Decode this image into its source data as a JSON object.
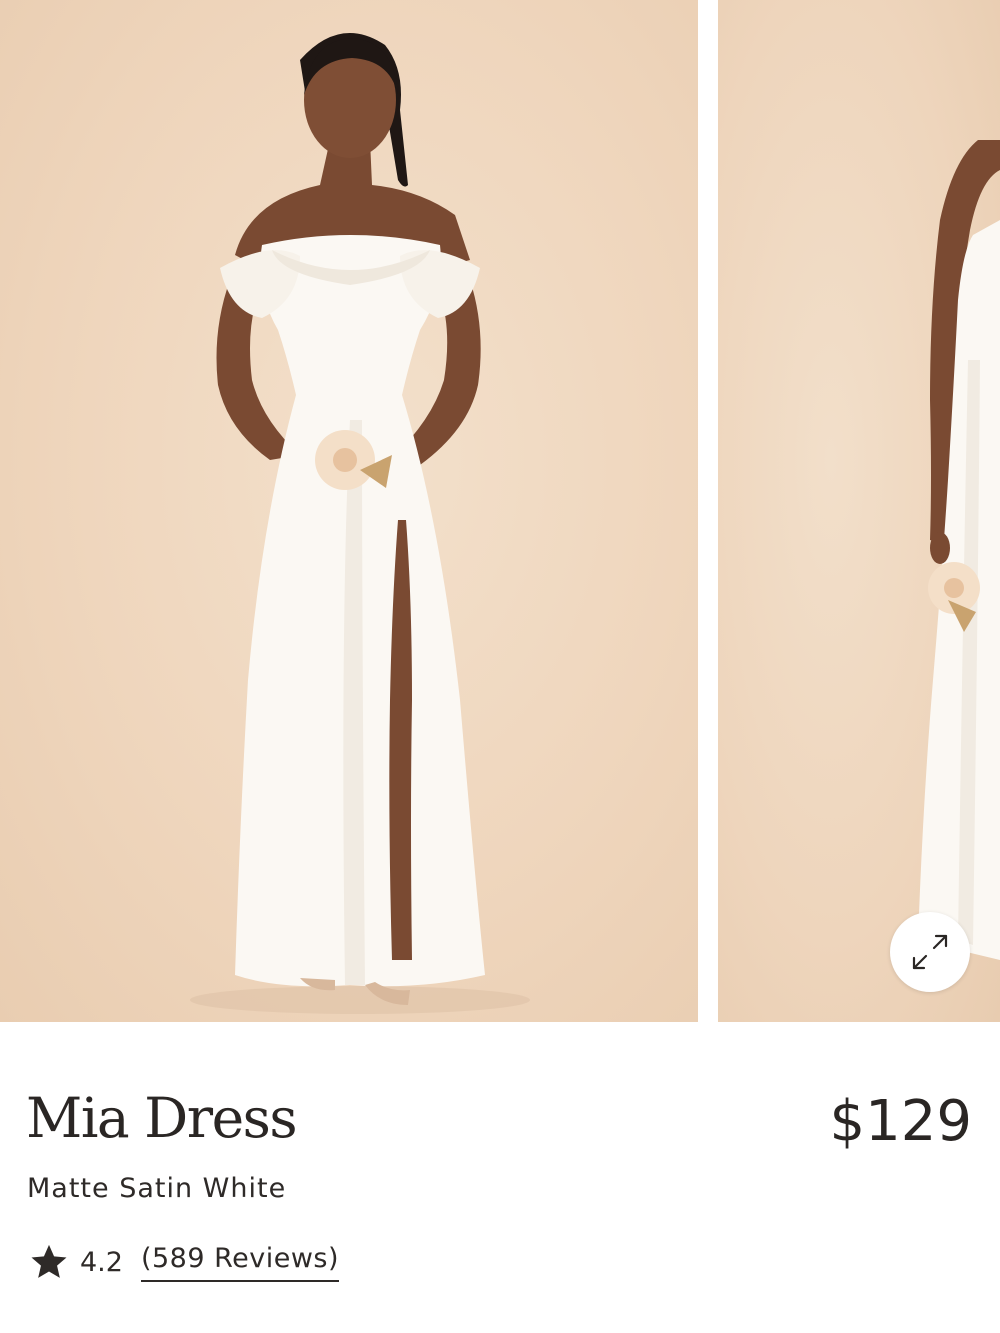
{
  "gallery": {
    "images": [
      {
        "name": "product-photo-front",
        "background_color": "#efd6bd"
      },
      {
        "name": "product-photo-side",
        "background_color": "#eed5bc"
      }
    ],
    "expand_icon": "expand-arrows-icon"
  },
  "product": {
    "name": "Mia Dress",
    "variant": "Matte Satin White",
    "price": "$129",
    "rating": {
      "icon": "star-icon",
      "value": "4.2",
      "reviews_label": "(589 Reviews)"
    }
  },
  "colors": {
    "text": "#2a2624",
    "photo_background": "#efd6bd",
    "dress": "#fbf8f3"
  }
}
